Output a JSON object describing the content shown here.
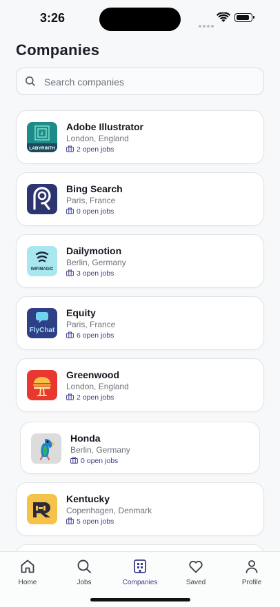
{
  "status": {
    "time": "3:26"
  },
  "page": {
    "title": "Companies"
  },
  "search": {
    "placeholder": "Search companies"
  },
  "companies": [
    {
      "name": "Adobe Illustrator",
      "location": "London, England",
      "jobs": "2 open jobs",
      "logo_text": "LABYRINTH",
      "logo_bg": "#1f8a8a"
    },
    {
      "name": "Bing Search",
      "location": "Paris, France",
      "jobs": "0 open jobs",
      "logo_text": "",
      "logo_bg": "#2d3570"
    },
    {
      "name": "Dailymotion",
      "location": "Berlin, Germany",
      "jobs": "3 open jobs",
      "logo_text": "WIFIMAGIC",
      "logo_bg": "#a8e6f0"
    },
    {
      "name": "Equity",
      "location": "Paris, France",
      "jobs": "6 open jobs",
      "logo_text": "FlyChat",
      "logo_bg": "#2f3f86"
    },
    {
      "name": "Greenwood",
      "location": "London, England",
      "jobs": "2 open jobs",
      "logo_text": "",
      "logo_bg": "#e8382f"
    },
    {
      "name": "Honda",
      "location": "Berlin, Germany",
      "jobs": "0 open jobs",
      "logo_text": "",
      "logo_bg": "#dcdcdc"
    },
    {
      "name": "Kentucky",
      "location": "Copenhagen, Denmark",
      "jobs": "5 open jobs",
      "logo_text": "",
      "logo_bg": "#f5c24a"
    }
  ],
  "tabs": [
    {
      "label": "Home",
      "icon": "home-icon",
      "active": false
    },
    {
      "label": "Jobs",
      "icon": "search-icon",
      "active": false
    },
    {
      "label": "Companies",
      "icon": "building-icon",
      "active": true
    },
    {
      "label": "Saved",
      "icon": "heart-icon",
      "active": false
    },
    {
      "label": "Profile",
      "icon": "person-icon",
      "active": false
    }
  ],
  "colors": {
    "accent": "#3d3c8a",
    "background": "#f6f8f9"
  }
}
